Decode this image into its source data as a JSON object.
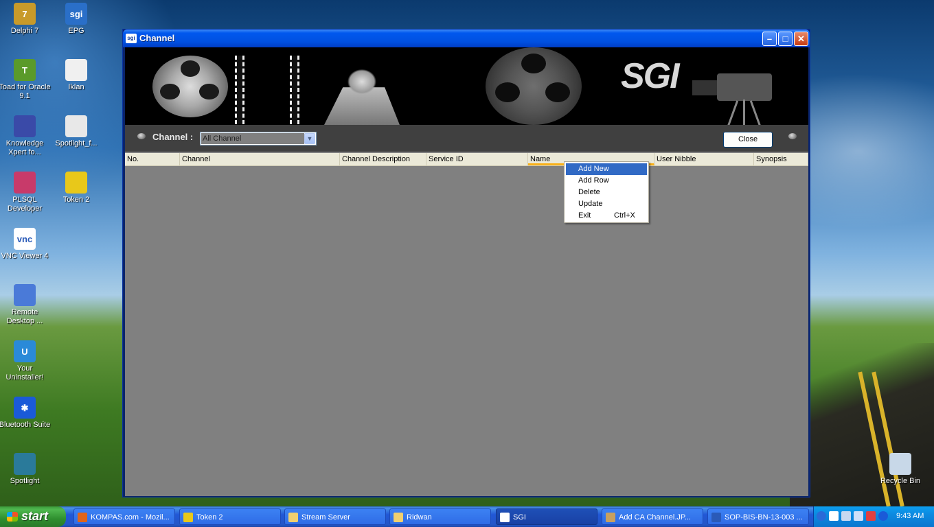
{
  "desktop": {
    "icons": [
      {
        "label": "Delphi 7",
        "glyph": "7",
        "icon": "delphi-icon",
        "color": "#c89a2a"
      },
      {
        "label": "EPG",
        "glyph": "sgi",
        "icon": "sgi-icon",
        "color": "#2a6fc8"
      },
      {
        "label": "Toad for Oracle 9.1",
        "glyph": "T",
        "icon": "toad-icon",
        "color": "#5a9a2a"
      },
      {
        "label": "Iklan",
        "glyph": "",
        "icon": "iklan-icon",
        "color": "#f0f0f0"
      },
      {
        "label": "Knowledge Xpert fo...",
        "glyph": "",
        "icon": "knowledge-xpert-icon",
        "color": "#3a4aa8"
      },
      {
        "label": "Spotlight_f...",
        "glyph": "",
        "icon": "spotlight-file-icon",
        "color": "#e8e8e8"
      },
      {
        "label": "PLSQL Developer",
        "glyph": "",
        "icon": "plsql-developer-icon",
        "color": "#c83a6a"
      },
      {
        "label": "Token 2",
        "glyph": "",
        "icon": "token-icon",
        "color": "#e8c81a"
      },
      {
        "label": "VNC Viewer 4",
        "glyph": "vnc",
        "icon": "vnc-viewer-icon",
        "color": "#ffffff"
      },
      {
        "label": "Remote Desktop ...",
        "glyph": "",
        "icon": "remote-desktop-icon",
        "color": "#4a7ad8"
      },
      {
        "label": "Your Uninstaller!",
        "glyph": "U",
        "icon": "uninstaller-icon",
        "color": "#2a8ad8"
      },
      {
        "label": "Bluetooth Suite",
        "glyph": "✱",
        "icon": "bluetooth-icon",
        "color": "#1a5ad8"
      },
      {
        "label": "Spotlight",
        "glyph": "",
        "icon": "spotlight-icon",
        "color": "#2a7a9a"
      },
      {
        "label": "Recycle Bin",
        "glyph": "",
        "icon": "recycle-bin-icon",
        "color": "#c8d8e8"
      }
    ]
  },
  "window": {
    "title": "Channel",
    "title_icon": "sgi",
    "banner_logo": "SGI",
    "toolbar": {
      "channel_label": "Channel :",
      "channel_value": "All Channel",
      "close_label": "Close"
    },
    "columns": [
      "No.",
      "Channel",
      "Channel Description",
      "Service ID",
      "Name",
      "User Nibble",
      "Synopsis"
    ]
  },
  "context_menu": {
    "items": [
      {
        "label": "Add New",
        "shortcut": ""
      },
      {
        "label": "Add Row",
        "shortcut": ""
      },
      {
        "label": "Delete",
        "shortcut": ""
      },
      {
        "label": "Update",
        "shortcut": ""
      },
      {
        "label": "Exit",
        "shortcut": "Ctrl+X"
      }
    ]
  },
  "taskbar": {
    "start_label": "start",
    "tasks": [
      {
        "label": "KOMPAS.com - Mozil...",
        "icon": "firefox-icon",
        "color": "#e0641a"
      },
      {
        "label": "Token 2",
        "icon": "token-icon",
        "color": "#e8c81a"
      },
      {
        "label": "Stream Server",
        "icon": "folder-icon",
        "color": "#f0d070"
      },
      {
        "label": "Ridwan",
        "icon": "folder-icon",
        "color": "#f0d070"
      },
      {
        "label": "SGI",
        "icon": "sgi-icon",
        "color": "#ffffff"
      },
      {
        "label": "Add CA Channel.JP...",
        "icon": "image-viewer-icon",
        "color": "#c8a060"
      },
      {
        "label": "SOP-BIS-BN-13-003 ...",
        "icon": "word-icon",
        "color": "#2a5ab8"
      }
    ],
    "clock": "9:43 AM"
  }
}
